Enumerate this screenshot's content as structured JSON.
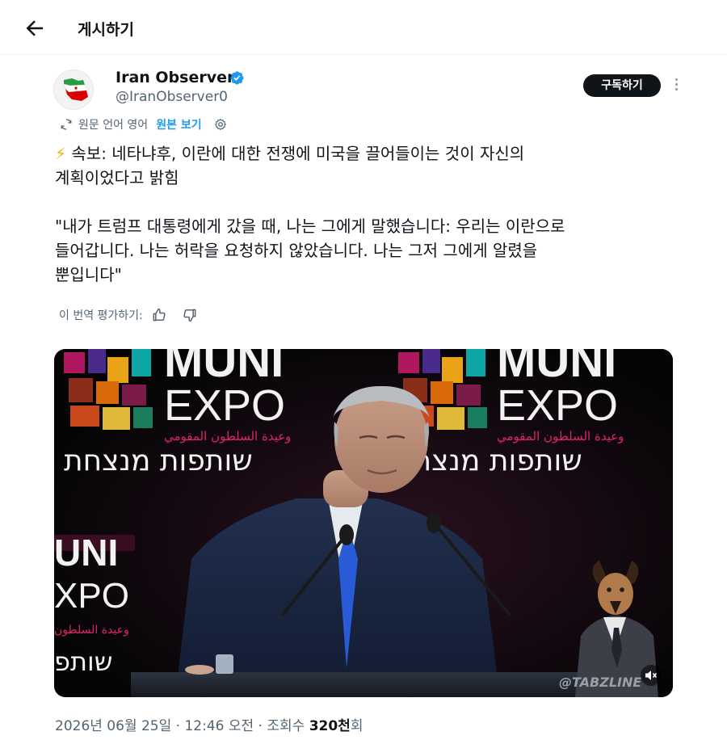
{
  "header": {
    "title": "게시하기",
    "back_icon": "back-arrow-icon"
  },
  "author": {
    "display_name": "Iran Observer",
    "handle": "@IranObserver0",
    "verified": true,
    "verified_color": "#1d9bf0",
    "avatar_icon": "iran-flag-map-icon"
  },
  "actions": {
    "subscribe_label": "구독하기",
    "more_icon": "more-vertical-icon"
  },
  "translation": {
    "source_label": "원문 언어 영어",
    "show_original_label": "원본 보기",
    "translate_icon": "translate-icon",
    "settings_icon": "gear-icon"
  },
  "tweet": {
    "bolt": "⚡",
    "line1": " 속보: 네타냐후, 이란에 대한 전쟁에 미국을 끌어들이는 것이 자신의\n계획이었다고 밝힘",
    "quote": "\"내가 트럼프 대통령에게 갔을 때, 나는 그에게 말했습니다: 우리는 이란으로\n들어갑니다. 나는 허락을 요청하지 않았습니다. 나는 그저 그에게 알렸을\n뿐입니다\""
  },
  "rating": {
    "label": "이 번역 평가하기:",
    "thumbs_up_icon": "thumbs-up-icon",
    "thumbs_down_icon": "thumbs-down-icon"
  },
  "media": {
    "left_banner_top": "MUNI",
    "left_banner_bottom": "EXPO",
    "arabic_tagline": "وعيدة السلطون المقومي",
    "hebrew_tagline": "שותפות מנצחת",
    "side_banner_top": "UNI",
    "side_banner_bottom": "XPO",
    "side_arabic": "وعيدة السلطون",
    "side_hebrew": "שותפ",
    "watermark": "@TABZLINE",
    "mute_icon": "mute-speaker-icon"
  },
  "meta": {
    "timestamp": "2026년 06월 25일 · 12:46 오전 · 조회수 ",
    "views": "320천",
    "views_suffix": "회"
  },
  "colors": {
    "accent": "#1d9bf0",
    "text": "#0f1419",
    "muted": "#536471"
  }
}
